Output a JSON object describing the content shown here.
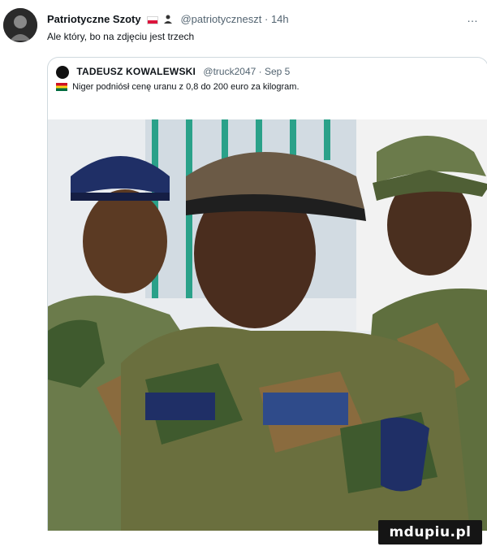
{
  "post": {
    "author_name": "Patriotyczne Szoty",
    "handle": "@patriotyczneszt",
    "time_ago": "14h",
    "more_icon": "…",
    "text": "Ale który, bo na zdjęciu jest trzech"
  },
  "quoted_post": {
    "author_name": "TADEUSZ KOWALEWSKI",
    "handle": "@truck2047",
    "date": "Sep 5",
    "text": "Niger podniósł cenę uranu z 0,8 do 200 euro za kilogram."
  },
  "watermark": {
    "text": "mdupiu.pl"
  },
  "colors": {
    "muted": "#536471",
    "border": "#cfd9de"
  },
  "icons": {
    "more": "more-options-icon",
    "poland_flag": "poland-flag-icon",
    "ghana_flag": "ghana-flag-icon"
  }
}
